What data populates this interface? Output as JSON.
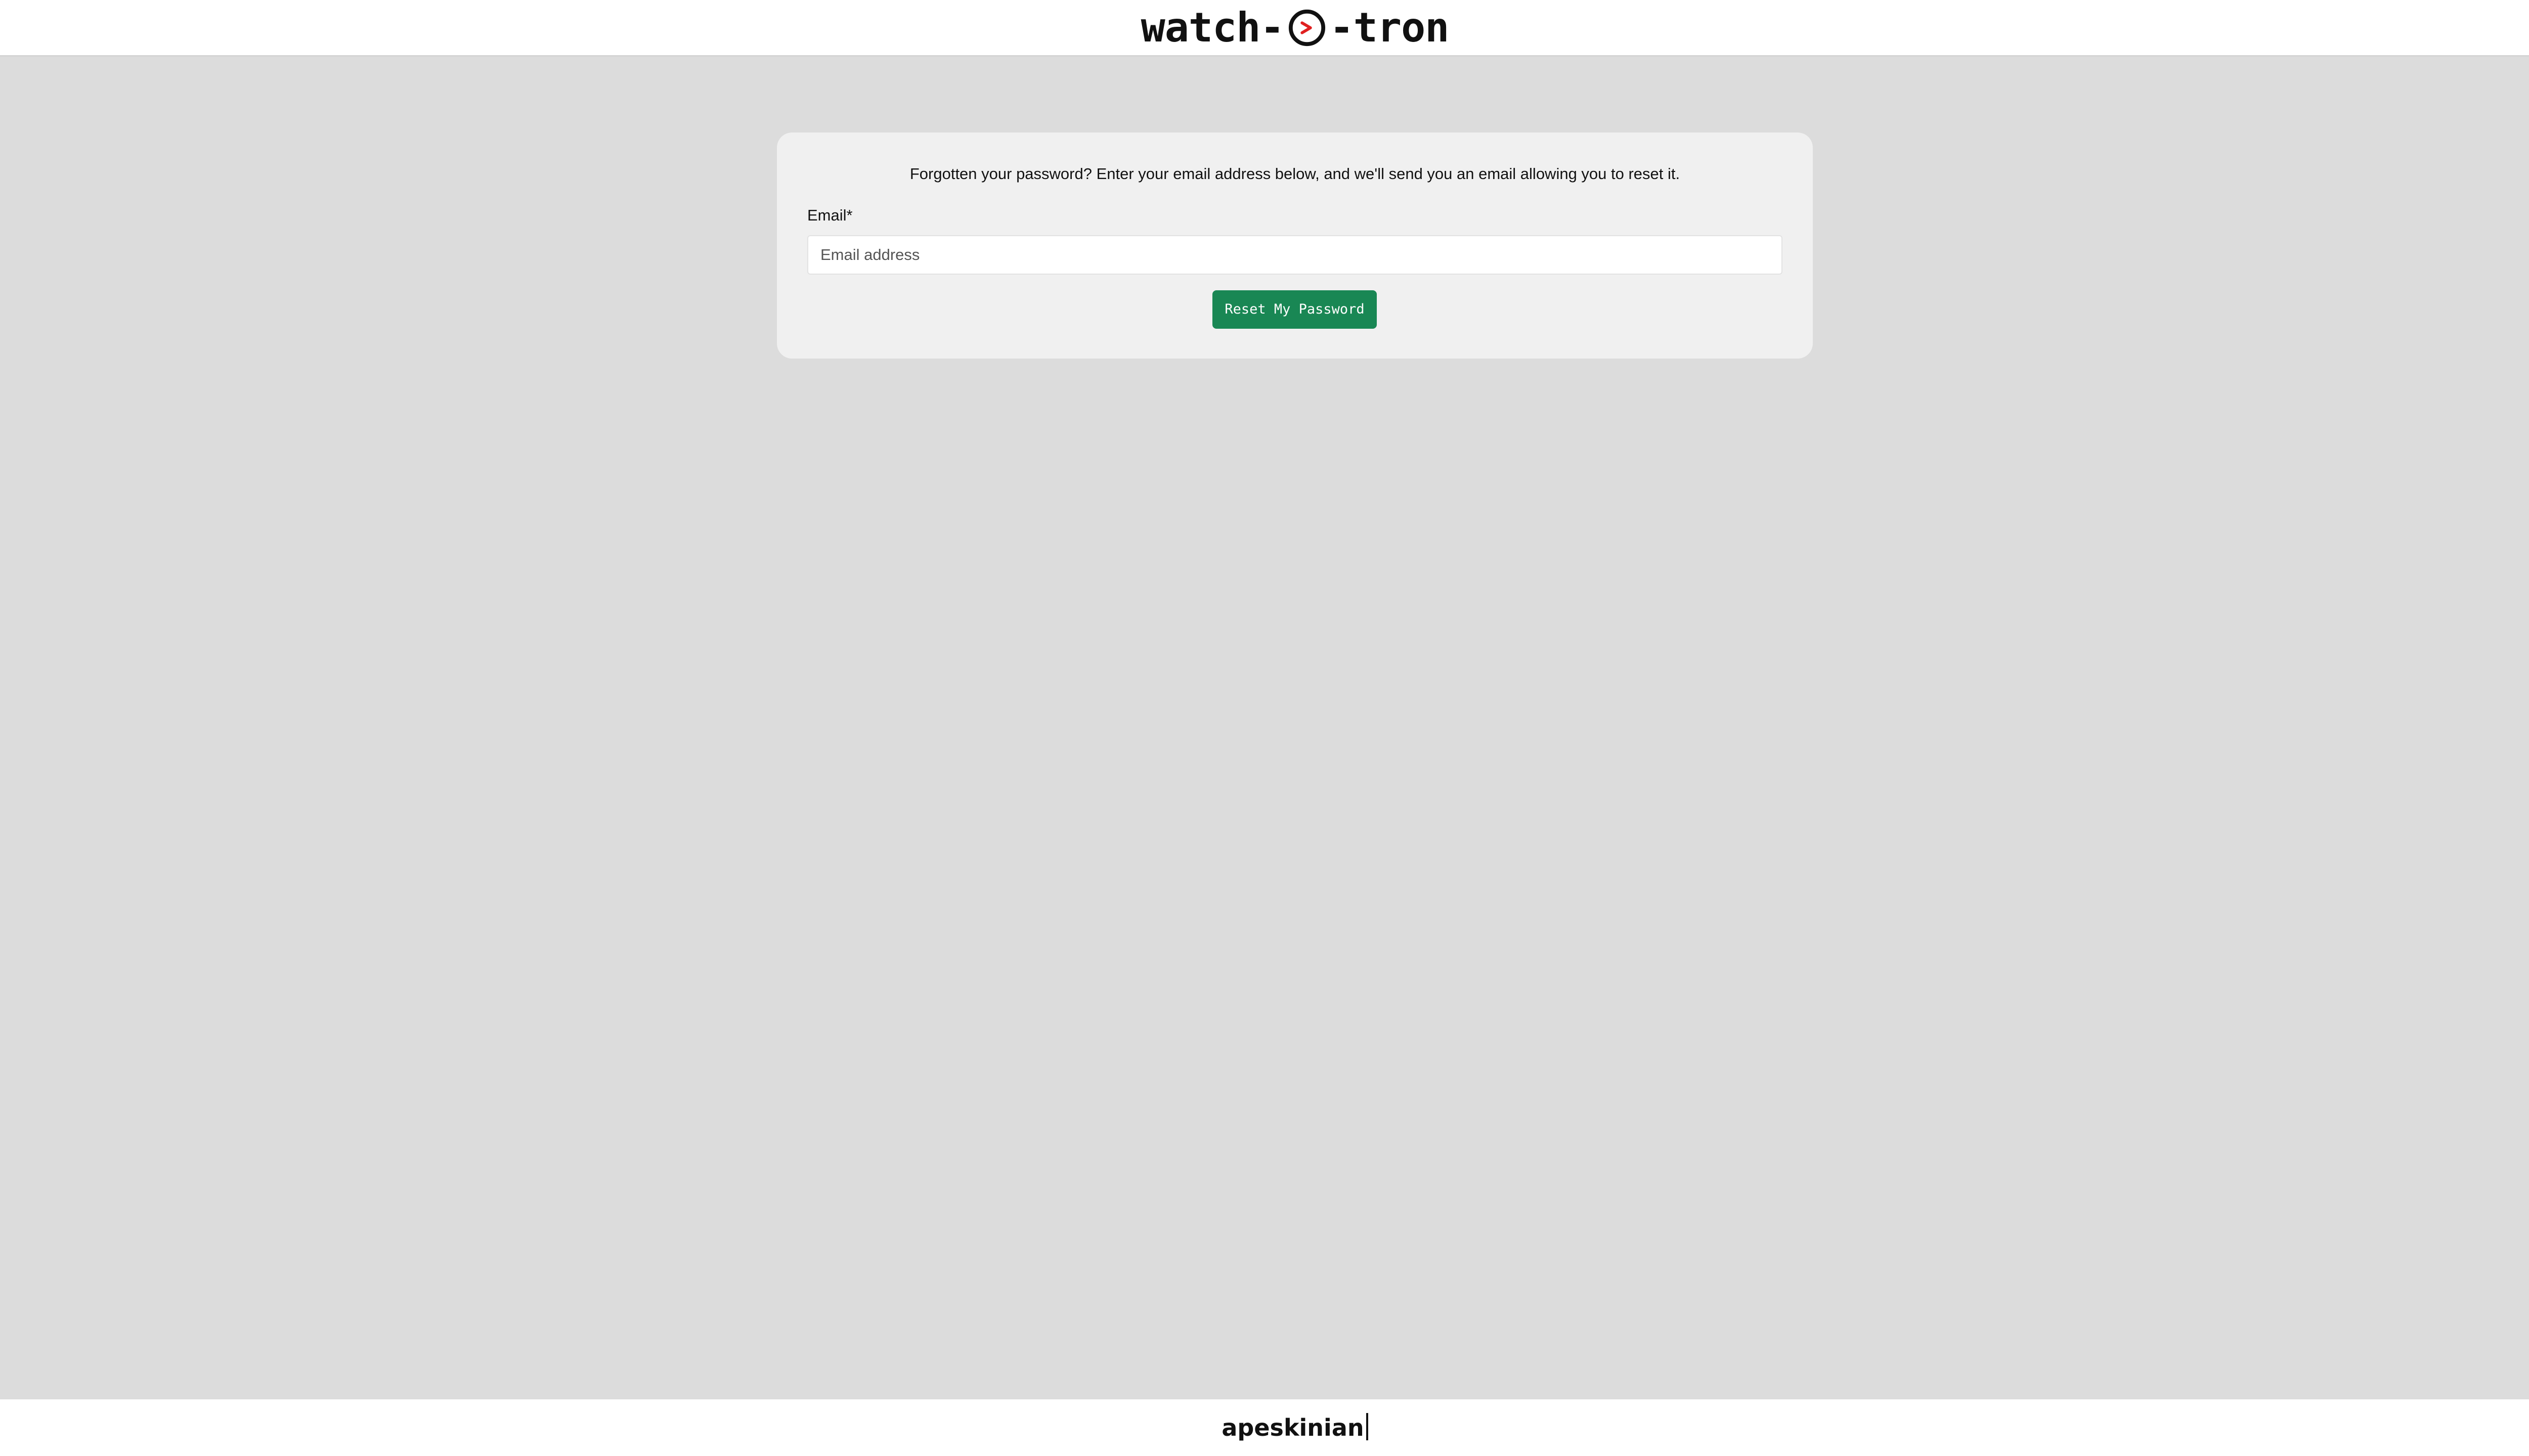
{
  "header": {
    "logo_left": "watch-",
    "logo_right": "-tron",
    "logo_icon": "clock-icon",
    "accent_color": "#e02020"
  },
  "reset_form": {
    "intro": "Forgotten your password? Enter your email address below, and we'll send you an email allowing you to reset it.",
    "email_label": "Email*",
    "email_value": "",
    "email_placeholder": "Email address",
    "submit_label": "Reset My Password",
    "submit_color": "#198754"
  },
  "footer": {
    "text": "apeskinian"
  }
}
